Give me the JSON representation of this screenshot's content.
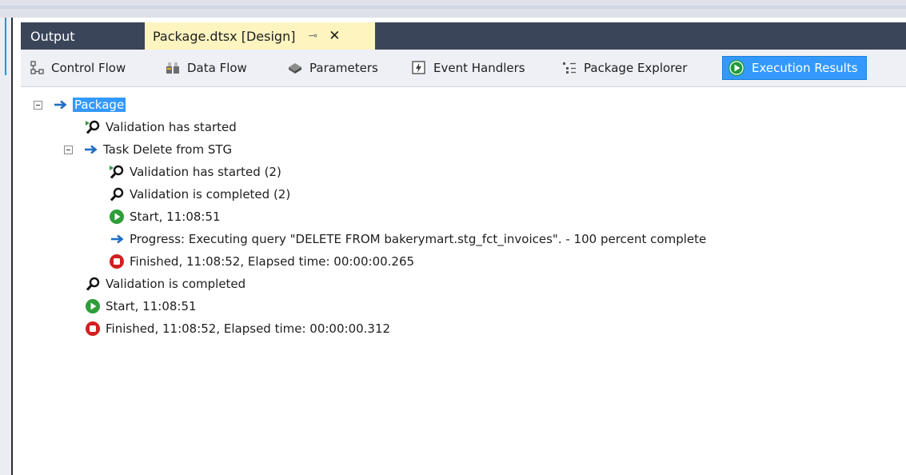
{
  "tabs": {
    "output": "Output",
    "package": "Package.dtsx [Design]"
  },
  "toolbar": {
    "items": [
      {
        "label": "Control Flow"
      },
      {
        "label": "Data Flow"
      },
      {
        "label": "Parameters"
      },
      {
        "label": "Event Handlers"
      },
      {
        "label": "Package Explorer"
      },
      {
        "label": "Execution Results"
      }
    ]
  },
  "colors": {
    "tab_bar": "#3a4559",
    "active_tab": "#fdf4bf",
    "selection": "#3399ff",
    "start_green": "#2e9d3a",
    "finish_red": "#d21f1f"
  },
  "tree": {
    "root": "Package",
    "lines": [
      {
        "icon": "validation-started-icon",
        "text": "Validation has started"
      },
      {
        "icon": "arrow-right-icon",
        "text": "Task Delete from STG"
      },
      {
        "icon": "validation-started-icon",
        "text": "Validation has started (2)"
      },
      {
        "icon": "validation-completed-icon",
        "text": "Validation is completed (2)"
      },
      {
        "icon": "start-icon",
        "text": "Start, 11:08:51"
      },
      {
        "icon": "arrow-right-icon",
        "text": "Progress: Executing query \"DELETE FROM bakerymart.stg_fct_invoices\". - 100 percent complete"
      },
      {
        "icon": "finished-icon",
        "text": "Finished, 11:08:52, Elapsed time: 00:00:00.265"
      },
      {
        "icon": "validation-completed-icon",
        "text": "Validation is completed"
      },
      {
        "icon": "start-icon",
        "text": "Start, 11:08:51"
      },
      {
        "icon": "finished-icon",
        "text": "Finished, 11:08:52, Elapsed time: 00:00:00.312"
      }
    ]
  }
}
